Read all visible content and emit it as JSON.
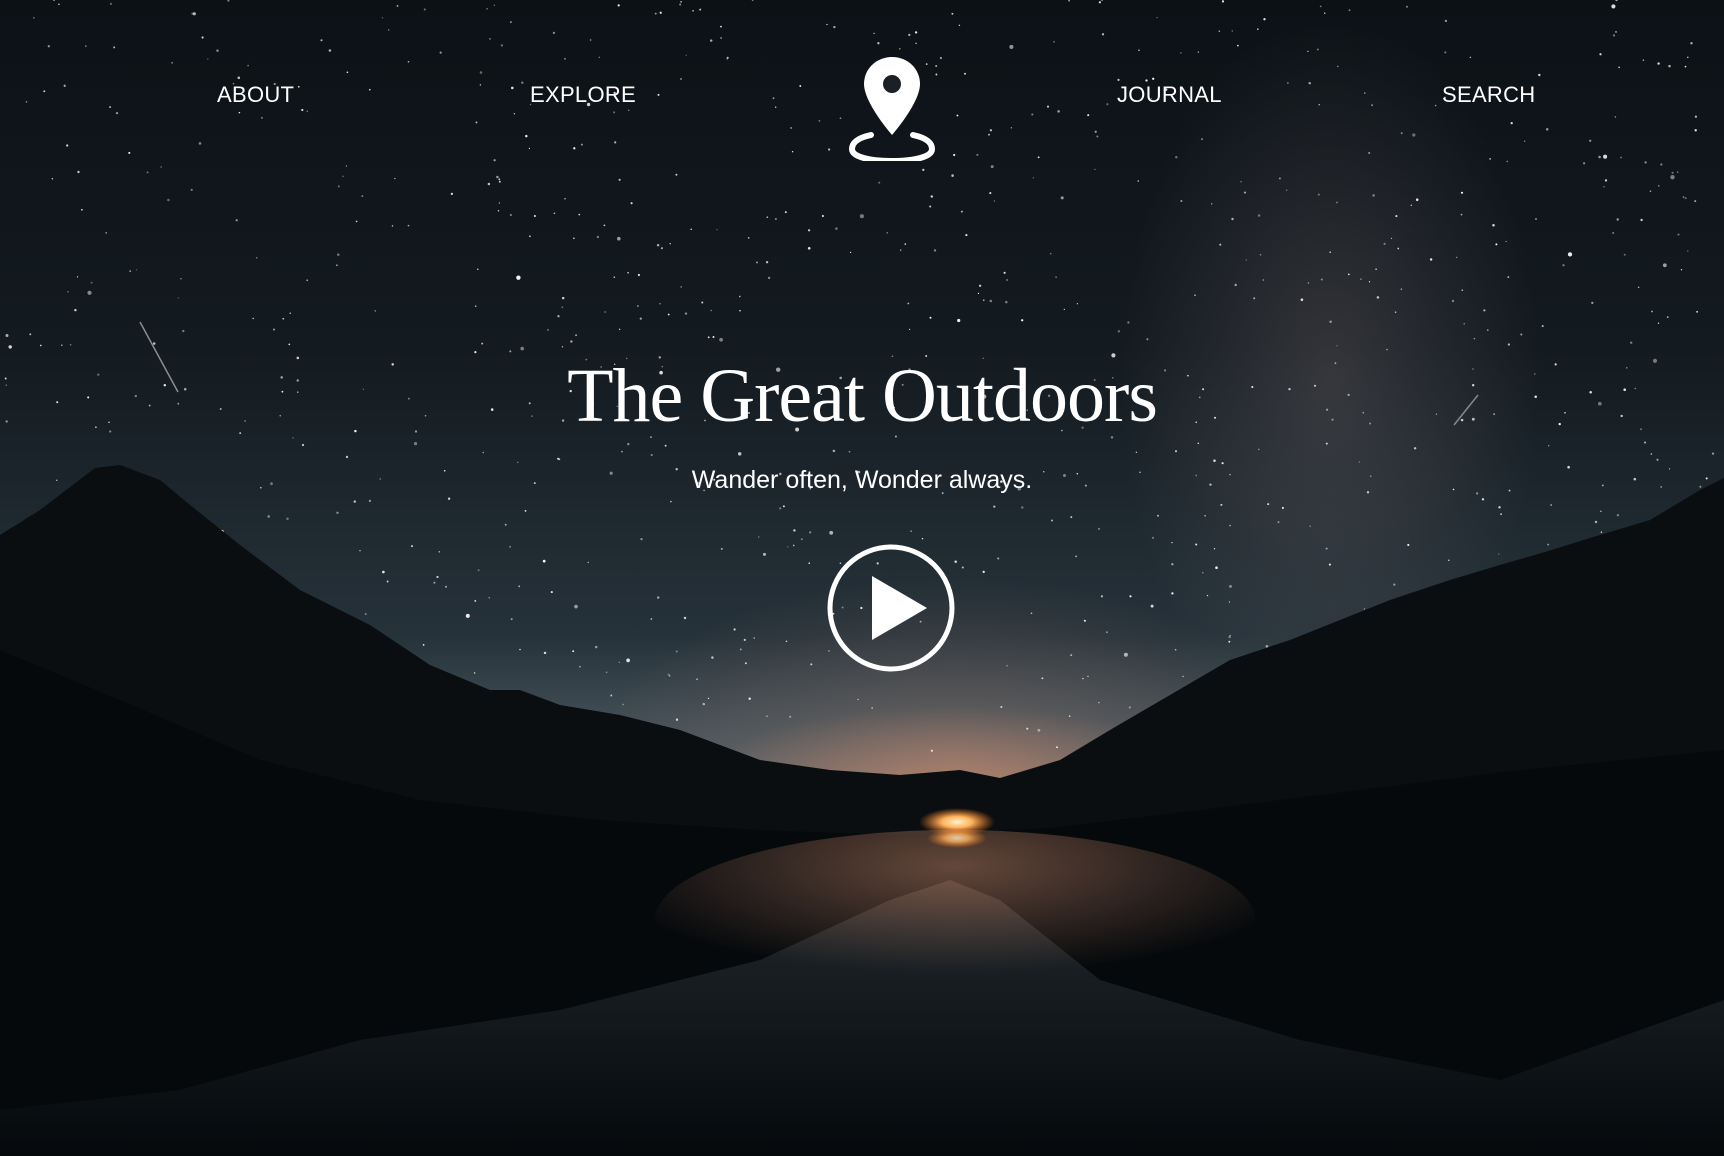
{
  "nav": {
    "items": [
      {
        "label": "ABOUT"
      },
      {
        "label": "EXPLORE"
      },
      {
        "label": "JOURNAL"
      },
      {
        "label": "SEARCH"
      }
    ],
    "logo_icon": "location-pin-icon"
  },
  "hero": {
    "title": "The  Great Outdoors",
    "subtitle": "Wander often, Wonder always.",
    "play_icon": "play-circle-icon"
  },
  "colors": {
    "text": "#ffffff",
    "sky": "#131a20",
    "horizon_glow": "#eb966e",
    "mountains": "#070b0e"
  }
}
